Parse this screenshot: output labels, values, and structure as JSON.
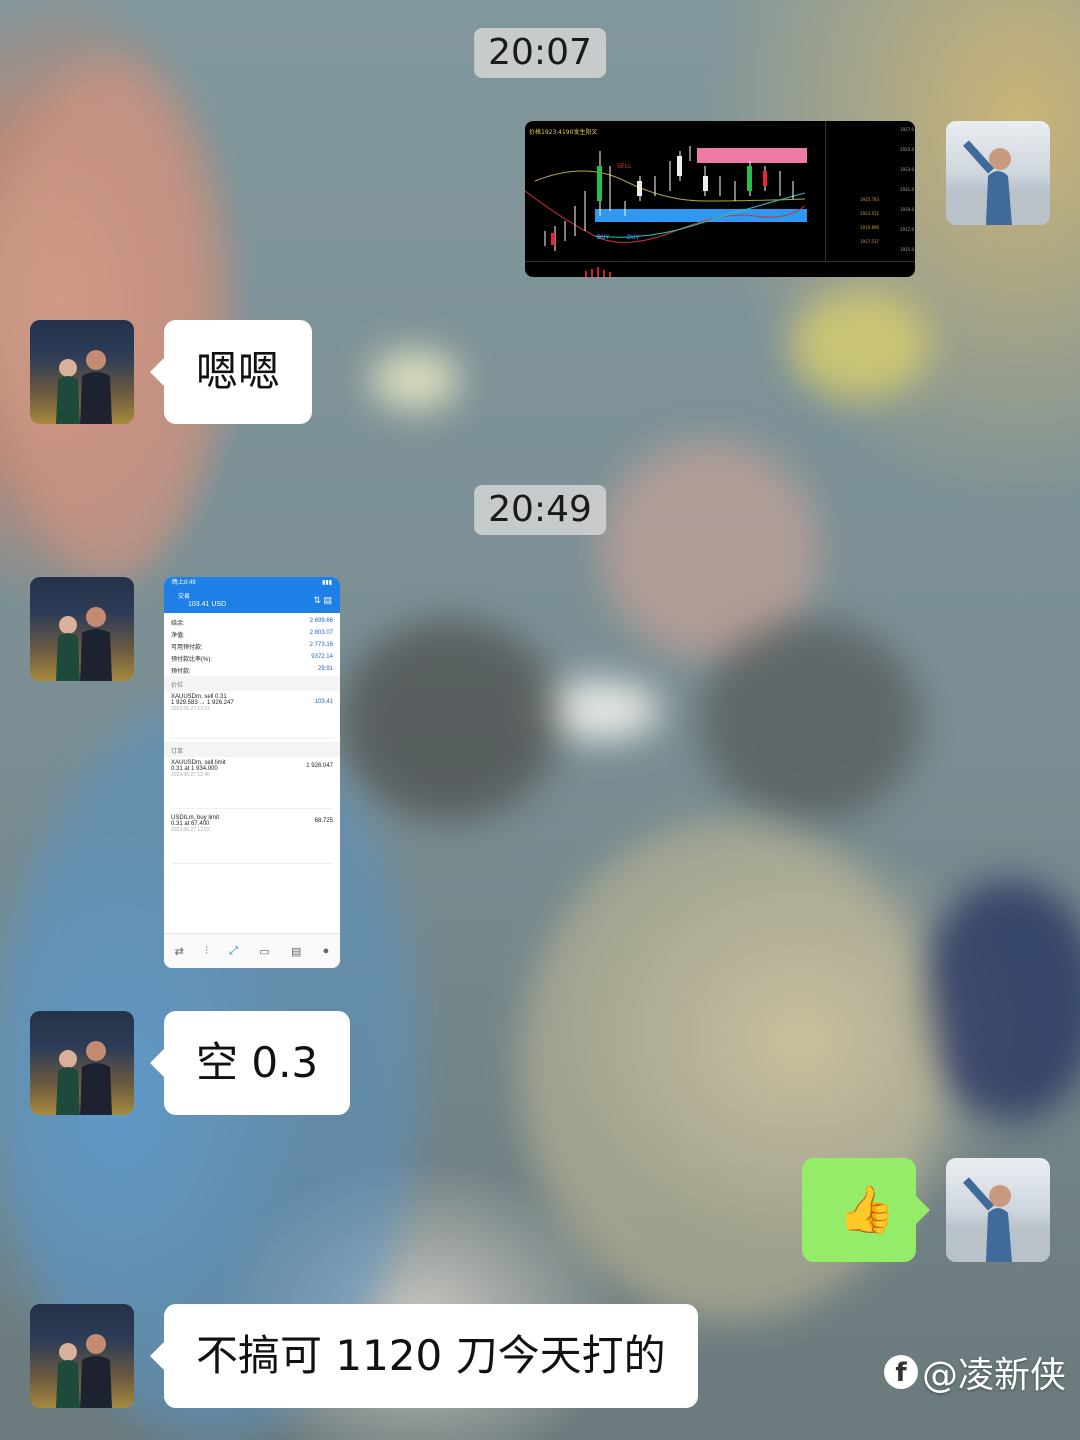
{
  "timestamps": [
    "20:07",
    "20:49"
  ],
  "messages": {
    "m1_text": "嗯嗯",
    "m2_text": "空 0.3",
    "m3_text": "不搞可 1120 刀今天打的",
    "thumb_emoji": "👍"
  },
  "chart_image": {
    "title": "价格1923.4190发生阳叉",
    "sell_label": "SELL",
    "buy_label_1": "BUY",
    "buy_label_2": "BUY"
  },
  "mt_screenshot": {
    "status_time": "晚上8:49",
    "header_title": "交易",
    "header_balance": "103.41 USD",
    "summary": [
      {
        "label": "结余:",
        "value": "2 699.66"
      },
      {
        "label": "净值:",
        "value": "2 803.07"
      },
      {
        "label": "可用预付款:",
        "value": "2 773.16"
      },
      {
        "label": "预付款比率(%):",
        "value": "9372.14"
      },
      {
        "label": "预付款:",
        "value": "29.91"
      }
    ],
    "section_positions": "价位",
    "position": {
      "symbol": "XAUUSDm, sell 0.31",
      "prices": "1 929.583 → 1 926.247",
      "profit": "103.41",
      "date": "2023.06.27 12:37"
    },
    "section_orders": "订单",
    "order1": {
      "symbol": "XAUUSDm, sell limit",
      "detail": "0.31 at 1 934.000",
      "price": "1 926.047",
      "date": "2023.06.27 12:40"
    },
    "order2": {
      "symbol": "USDILm, buy limit",
      "detail": "0.31 at 67.400",
      "price": "68.725",
      "date": "2023.06.27 12:02"
    }
  },
  "watermark": {
    "text": "@凌新侠"
  },
  "colors": {
    "bubble_white": "#ffffff",
    "bubble_green": "#95ec69",
    "mt_blue": "#1e7fe6"
  }
}
